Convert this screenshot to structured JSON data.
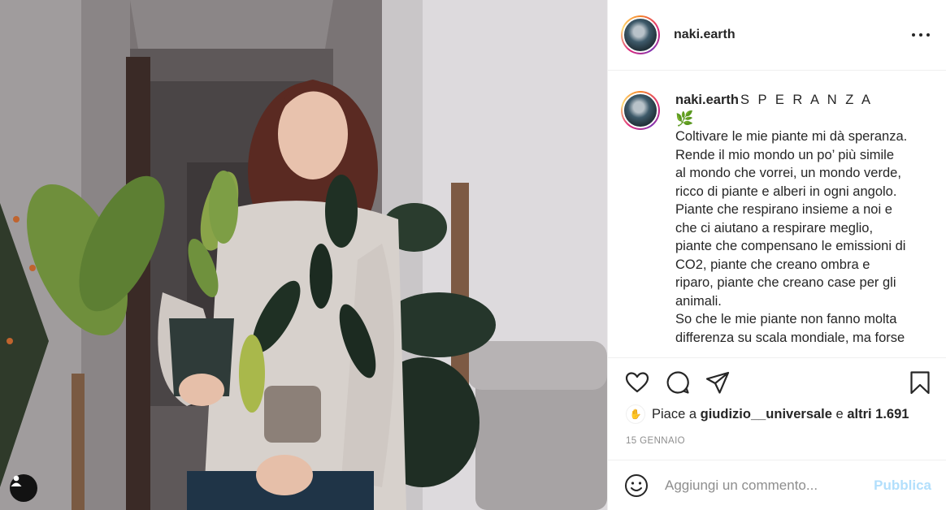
{
  "post": {
    "image_alt": "",
    "user_tag_icon": "user-icon"
  },
  "header": {
    "username": "naki.earth",
    "more_icon": "more-options-icon"
  },
  "caption": {
    "username": "naki.earth",
    "title": "S P E R A N Z A",
    "emoji": "🌿",
    "lines": [
      "Coltivare le mie piante mi dà speranza.",
      "Rende il mio mondo un po’ più simile",
      "al mondo che vorrei, un mondo verde,",
      "ricco di piante e alberi in ogni angolo.",
      "Piante che respirano insieme a noi e",
      "che ci aiutano a respirare meglio,",
      "piante che compensano le emissioni di",
      "CO2, piante che creano ombra e",
      "riparo, piante che creano case per gli",
      "animali.",
      "So che le mie piante non fanno molta",
      "differenza su scala mondiale, ma forse"
    ]
  },
  "actions": {
    "like_icon": "heart-icon",
    "comment_icon": "comment-icon",
    "share_icon": "share-icon",
    "save_icon": "bookmark-icon"
  },
  "likes": {
    "prefix": "Piace a",
    "user": "giudizio__universale",
    "connector": "e",
    "others": "altri 1.691"
  },
  "date": "15 GENNAIO",
  "comment": {
    "placeholder": "Aggiungi un commento...",
    "post_label": "Pubblica",
    "emoji_icon": "smiley-icon"
  },
  "colors": {
    "text": "#262626",
    "muted": "#8e8e8e",
    "border": "#efefef",
    "post_disabled": "#b2dffc"
  }
}
